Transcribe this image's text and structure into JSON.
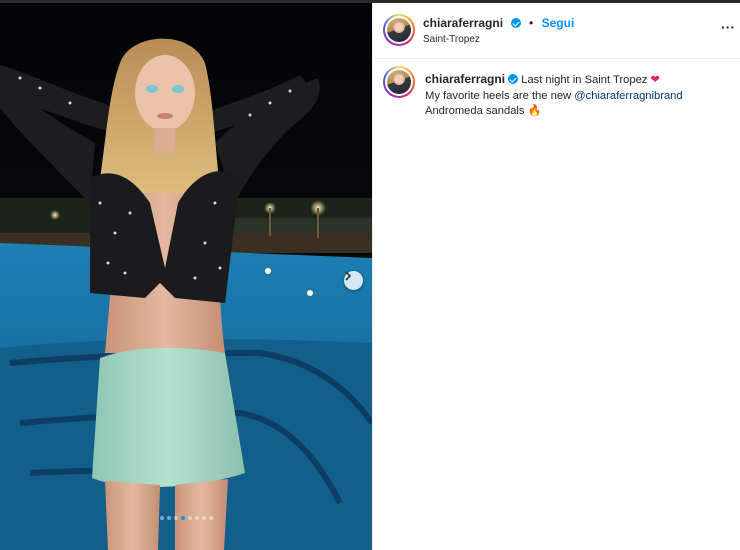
{
  "post": {
    "username": "chiaraferragni",
    "separator": "•",
    "follow_label": "Segui",
    "location": "Saint-Tropez",
    "more_label": "···",
    "caption": {
      "text_1": "Last night in Saint Tropez",
      "emoji_1": "❤",
      "text_2": "My favorite heels are the new",
      "mention": "@chiaraferragnibrand",
      "text_3": "Andromeda sandals",
      "emoji_2": "🔥"
    }
  },
  "media": {
    "description_icon": "photo-carousel",
    "carousel_dots": 8,
    "active_dot_index": 3,
    "next_icon": "chevron-right-icon"
  },
  "colors": {
    "accent": "#0095f6",
    "text": "#262626",
    "mention": "#00376b"
  }
}
